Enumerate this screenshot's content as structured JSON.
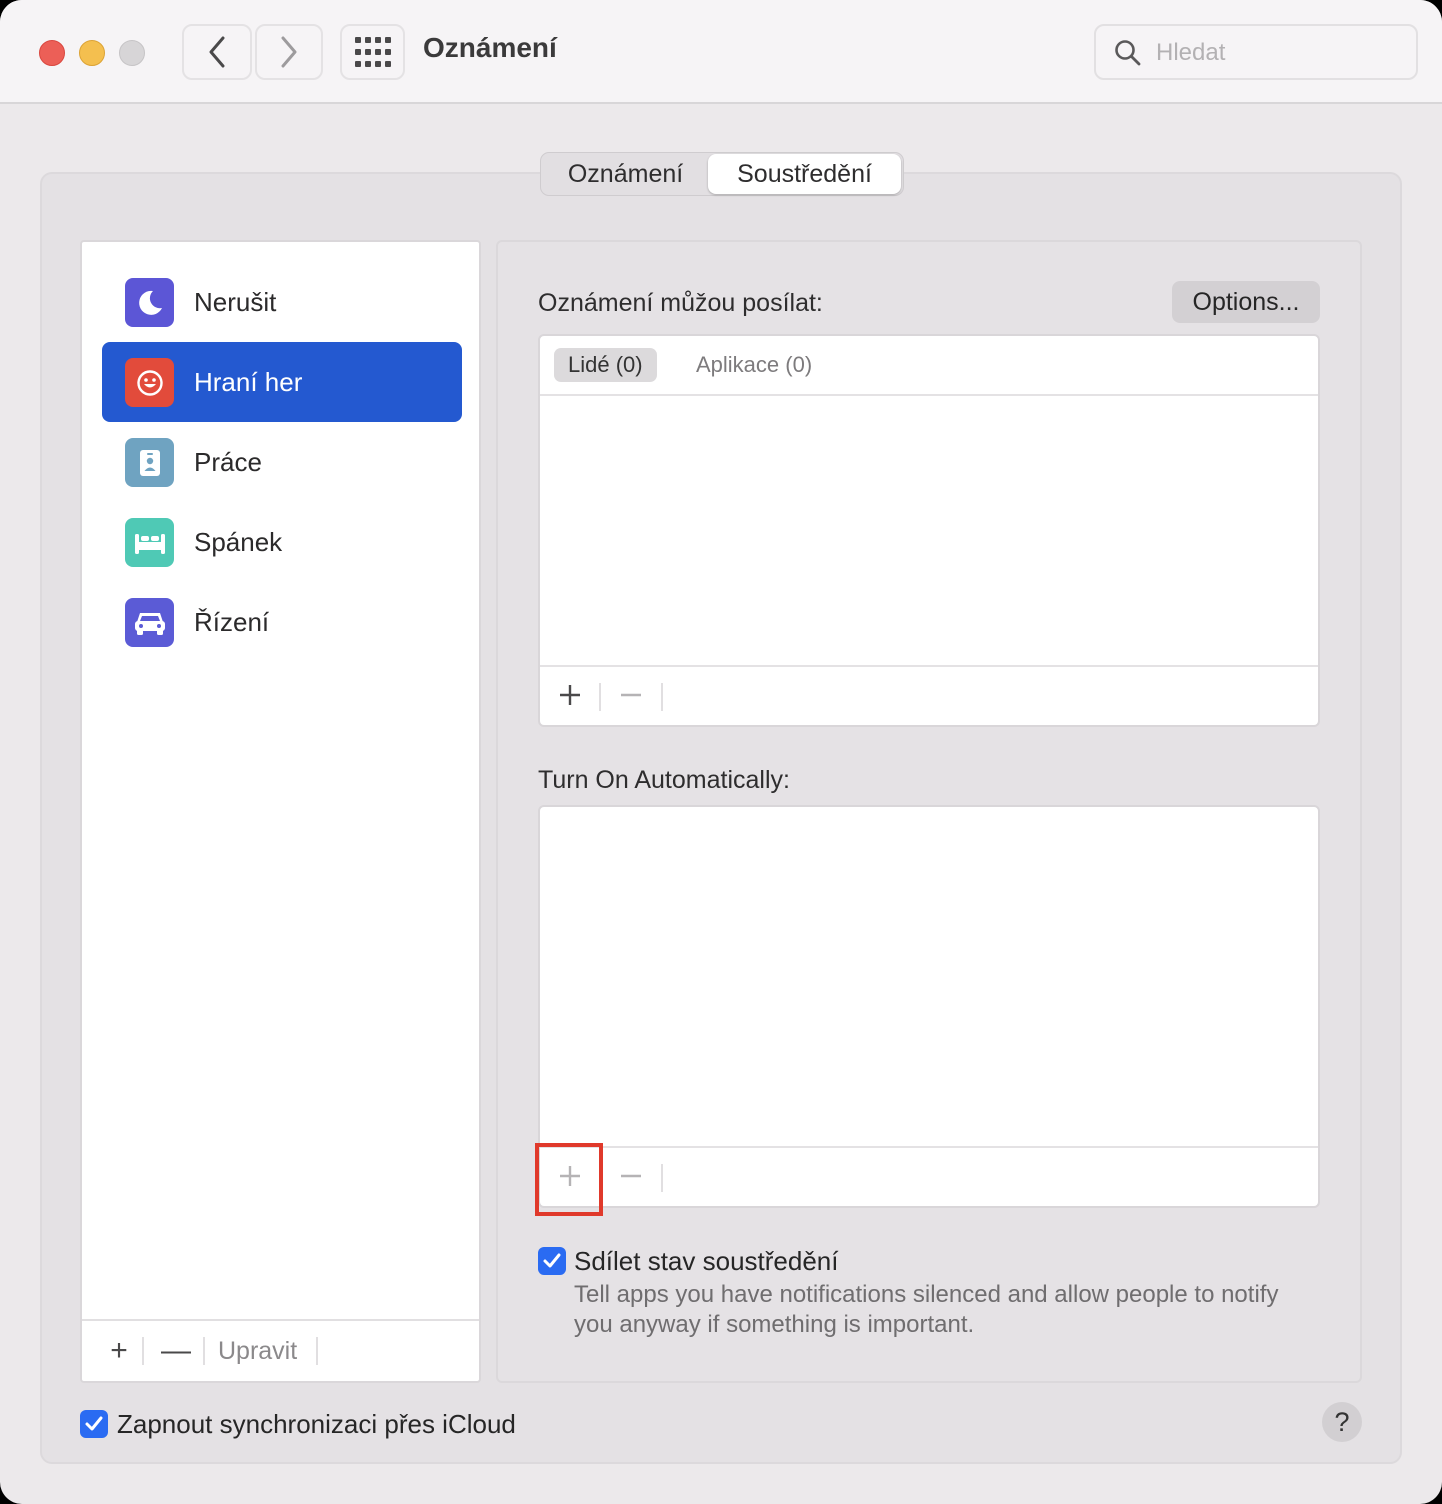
{
  "window": {
    "title": "Oznámení",
    "search_placeholder": "Hledat"
  },
  "segments": [
    {
      "label": "Oznámení",
      "selected": false
    },
    {
      "label": "Soustředění",
      "selected": true
    }
  ],
  "sidebar": {
    "items": [
      {
        "label": "Nerušit",
        "icon": "moon-icon",
        "color": "#5c56d6",
        "selected": false
      },
      {
        "label": "Hraní her",
        "icon": "smiley-icon",
        "color": "#e24b3b",
        "selected": true
      },
      {
        "label": "Práce",
        "icon": "id-badge-icon",
        "color": "#6fa3c1",
        "selected": false
      },
      {
        "label": "Spánek",
        "icon": "bed-icon",
        "color": "#4fc9b5",
        "selected": false
      },
      {
        "label": "Řízení",
        "icon": "car-icon",
        "color": "#5b5bd6",
        "selected": false
      }
    ],
    "footer": {
      "add": "+",
      "remove": "—",
      "edit": "Upravit"
    }
  },
  "panel": {
    "allowed_label": "Oznámení můžou posílat:",
    "options_button": "Options...",
    "allowed_tabs": [
      {
        "label": "Lidé (0)",
        "active": true
      },
      {
        "label": "Aplikace (0)",
        "active": false
      }
    ],
    "auto_label": "Turn On Automatically:",
    "share_status": {
      "checked": true,
      "label": "Sdílet stav soustředění",
      "description": "Tell apps you have notifications silenced and allow people to notify you anyway if something is important."
    }
  },
  "icloud_sync": {
    "checked": true,
    "label": "Zapnout synchronizaci přes iCloud"
  },
  "help": "?",
  "colors": {
    "accent": "#2459d0",
    "checkbox": "#2a6bf2",
    "highlight": "#e0392b"
  }
}
